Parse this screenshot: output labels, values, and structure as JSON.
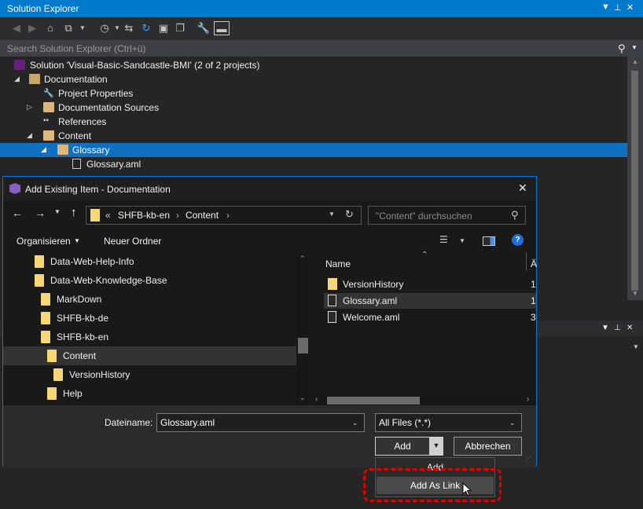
{
  "solution_explorer": {
    "title": "Solution Explorer",
    "search_placeholder": "Search Solution Explorer (Ctrl+ü)",
    "tree": [
      {
        "label": "Solution 'Visual-Basic-Sandcastle-BMI' (2 of 2 projects)",
        "icon": "solution-icon"
      },
      {
        "label": "Documentation",
        "icon": "project-icon",
        "expanded": true
      },
      {
        "label": "Project Properties",
        "icon": "wrench-icon"
      },
      {
        "label": "Documentation Sources",
        "icon": "folder-icon",
        "expanded": false
      },
      {
        "label": "References",
        "icon": "references-icon"
      },
      {
        "label": "Content",
        "icon": "folder-icon",
        "expanded": true
      },
      {
        "label": "Glossary",
        "icon": "folder-icon",
        "expanded": true,
        "selected": true
      },
      {
        "label": "Glossary.aml",
        "icon": "file-icon"
      }
    ]
  },
  "dialog": {
    "title": "Add Existing Item - Documentation",
    "breadcrumb": [
      "«",
      "SHFB-kb-en",
      "Content"
    ],
    "search_placeholder": "\"Content\" durchsuchen",
    "organize_label": "Organisieren",
    "new_folder_label": "Neuer Ordner",
    "nav_items": [
      {
        "label": "Data-Web-Help-Info"
      },
      {
        "label": "Data-Web-Knowledge-Base"
      },
      {
        "label": "MarkDown"
      },
      {
        "label": "SHFB-kb-de"
      },
      {
        "label": "SHFB-kb-en"
      },
      {
        "label": "Content",
        "selected": true
      },
      {
        "label": "VersionHistory"
      },
      {
        "label": "Help"
      }
    ],
    "column_name": "Name",
    "column_next": "Ä",
    "files": [
      {
        "name": "VersionHistory",
        "type": "folder",
        "extra": "1"
      },
      {
        "name": "Glossary.aml",
        "type": "file",
        "extra": "1",
        "selected": true
      },
      {
        "name": "Welcome.aml",
        "type": "file",
        "extra": "3"
      }
    ],
    "filename_label": "Dateiname:",
    "filename_value": "Glossary.aml",
    "filter_value": "All Files (*.*)",
    "add_label": "Add",
    "cancel_label": "Abbrechen"
  },
  "menu": {
    "items": [
      "Add",
      "Add As Link"
    ],
    "highlighted": "Add As Link"
  },
  "colors": {
    "accent": "#007acc",
    "selection": "#0e70c0",
    "highlight_box": "#e00000",
    "folder": "#f8d775"
  }
}
